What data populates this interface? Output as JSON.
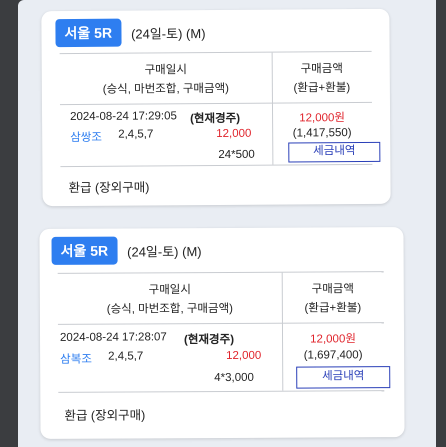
{
  "tickets": [
    {
      "race_badge": "서울 5R",
      "race_date": "(24일-토) (M)",
      "header_left_1": "구매일시",
      "header_left_2": "(승식, 마번조합, 구매금액)",
      "header_right_1": "구매금액",
      "header_right_2": "(환급+환불)",
      "purchase_time": "2024-08-24 17:29:05",
      "current_race": "(현재경주)",
      "bet_type": "삼쌍조",
      "numbers": "2,4,5,7",
      "bet_amount": "12,000",
      "combo": "24*500",
      "purchase_amount": "12,000원",
      "refund_amount": "(1,417,550)",
      "tax_button": "세금내역",
      "refund_type": "환급 (장외구매)"
    },
    {
      "race_badge": "서울 5R",
      "race_date": "(24일-토) (M)",
      "header_left_1": "구매일시",
      "header_left_2": "(승식, 마번조합, 구매금액)",
      "header_right_1": "구매금액",
      "header_right_2": "(환급+환불)",
      "purchase_time": "2024-08-24 17:28:07",
      "current_race": "(현재경주)",
      "bet_type": "삼복조",
      "numbers": "2,4,5,7",
      "bet_amount": "12,000",
      "combo": "4*3,000",
      "purchase_amount": "12,000원",
      "refund_amount": "(1,697,400)",
      "tax_button": "세금내역",
      "refund_type": "환급 (장외구매)"
    }
  ],
  "colors": {
    "badge": "#2e7ef0",
    "amount_red": "#e0232b",
    "tax_button_border": "#2a3fb8",
    "background": "#e9edf3"
  }
}
